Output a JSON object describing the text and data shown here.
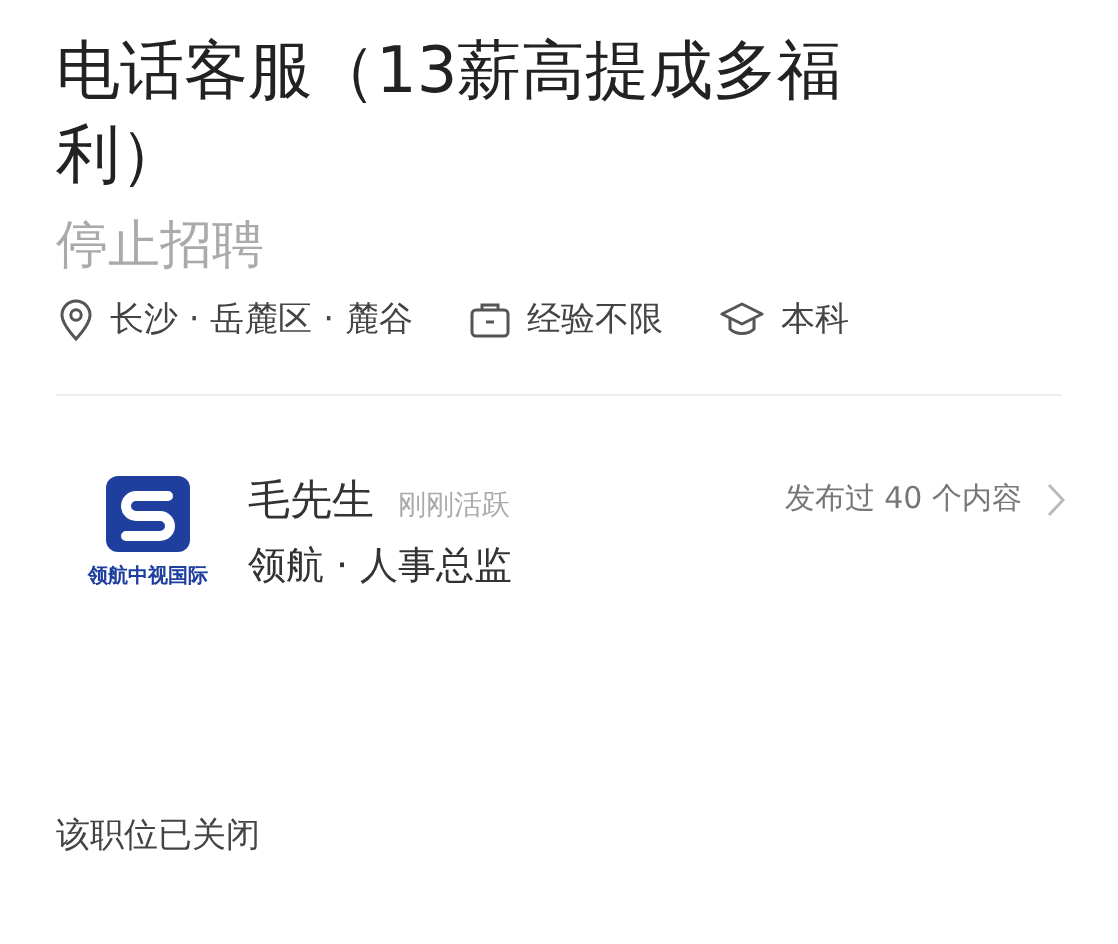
{
  "job": {
    "title": "电话客服（13薪高提成多福利）",
    "status": "停止招聘",
    "tags": [
      {
        "kind": "location",
        "text": "长沙 · 岳麓区 · 麓谷"
      },
      {
        "kind": "experience",
        "text": "经验不限"
      },
      {
        "kind": "education",
        "text": "本科"
      }
    ]
  },
  "recruiter": {
    "logo_text": "领航中视国际",
    "name": "毛先生",
    "activity": "刚刚活跃",
    "company_role": "领航 · 人事总监",
    "posts": "发布过 40 个内容"
  },
  "notice": "该职位已关闭"
}
